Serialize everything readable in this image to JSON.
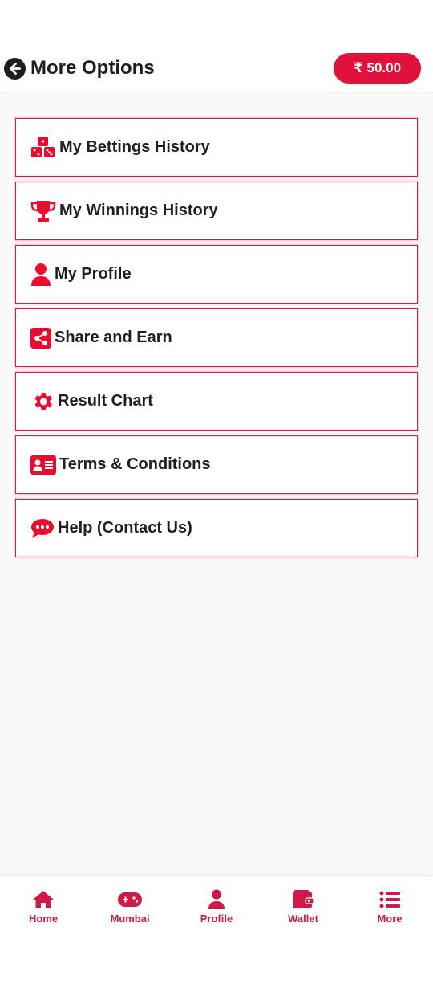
{
  "header": {
    "title": "More Options",
    "balance": "₹ 50.00"
  },
  "menu": {
    "items": [
      {
        "label": "My Bettings History",
        "icon": "cubes-icon"
      },
      {
        "label": "My Winnings History",
        "icon": "trophy-icon"
      },
      {
        "label": "My Profile",
        "icon": "user-icon"
      },
      {
        "label": "Share and Earn",
        "icon": "share-icon"
      },
      {
        "label": "Result Chart",
        "icon": "gear-icon"
      },
      {
        "label": "Terms & Conditions",
        "icon": "id-card-icon"
      },
      {
        "label": "Help (Contact Us)",
        "icon": "chat-icon"
      }
    ]
  },
  "bottom_nav": {
    "items": [
      {
        "label": "Home",
        "icon": "home-icon"
      },
      {
        "label": "Mumbai",
        "icon": "gamepad-icon"
      },
      {
        "label": "Profile",
        "icon": "user-icon"
      },
      {
        "label": "Wallet",
        "icon": "wallet-icon"
      },
      {
        "label": "More",
        "icon": "list-icon"
      }
    ]
  },
  "colors": {
    "accent": "#e0123b",
    "nav_label": "#d01a45",
    "background": "#f9f9f9"
  }
}
